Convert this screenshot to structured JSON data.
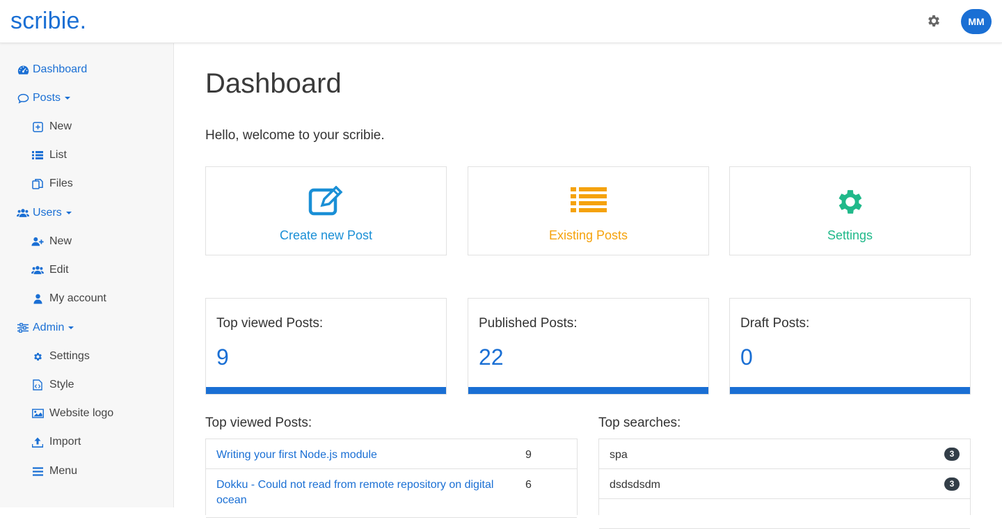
{
  "header": {
    "logo": "scribie.",
    "settings_icon": "gear-icon",
    "avatar_initials": "MM",
    "accent_color": "#1a6fd4"
  },
  "sidebar": {
    "dashboard": {
      "label": "Dashboard",
      "icon": "dashboard-icon"
    },
    "posts": {
      "label": "Posts",
      "icon": "comment-icon",
      "items": [
        {
          "label": "New",
          "icon": "plus-square-icon"
        },
        {
          "label": "List",
          "icon": "list-icon"
        },
        {
          "label": "Files",
          "icon": "files-icon"
        }
      ]
    },
    "users": {
      "label": "Users",
      "icon": "users-icon",
      "items": [
        {
          "label": "New",
          "icon": "user-plus-icon"
        },
        {
          "label": "Edit",
          "icon": "users-icon"
        },
        {
          "label": "My account",
          "icon": "user-icon"
        }
      ]
    },
    "admin": {
      "label": "Admin",
      "icon": "sliders-icon",
      "items": [
        {
          "label": "Settings",
          "icon": "gear-icon"
        },
        {
          "label": "Style",
          "icon": "code-file-icon"
        },
        {
          "label": "Website logo",
          "icon": "image-icon"
        },
        {
          "label": "Import",
          "icon": "upload-icon"
        },
        {
          "label": "Menu",
          "icon": "bars-icon"
        }
      ]
    }
  },
  "main": {
    "title": "Dashboard",
    "welcome": "Hello, welcome to your scribie.",
    "actions": [
      {
        "label": "Create new Post",
        "icon": "edit-icon",
        "color": "#1a8fd6"
      },
      {
        "label": "Existing Posts",
        "icon": "list-icon",
        "color": "#f5a20c"
      },
      {
        "label": "Settings",
        "icon": "gear-icon",
        "color": "#20b98a"
      }
    ],
    "stats": [
      {
        "label": "Top viewed Posts:",
        "value": "9"
      },
      {
        "label": "Published Posts:",
        "value": "22"
      },
      {
        "label": "Draft Posts:",
        "value": "0"
      }
    ],
    "top_viewed": {
      "title": "Top viewed Posts:",
      "rows": [
        {
          "title": "Writing your first Node.js module",
          "count": "9"
        },
        {
          "title": "Dokku - Could not read from remote repository on digital ocean",
          "count": "6"
        }
      ]
    },
    "top_searches": {
      "title": "Top searches:",
      "rows": [
        {
          "term": "spa",
          "count": "3"
        },
        {
          "term": "dsdsdsdm",
          "count": "3"
        }
      ]
    }
  }
}
